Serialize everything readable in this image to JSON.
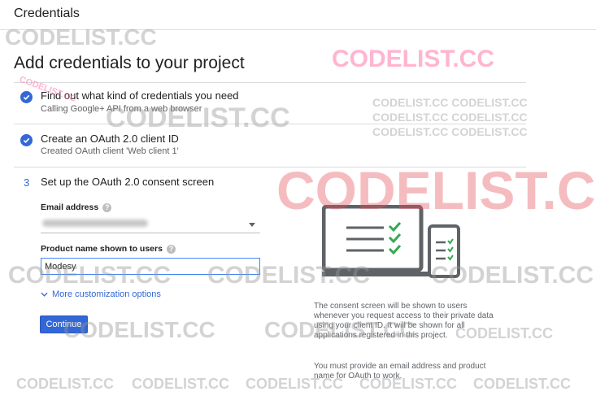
{
  "header": {
    "title": "Credentials"
  },
  "page": {
    "title": "Add credentials to your project"
  },
  "steps": [
    {
      "status": "complete",
      "title": "Find out what kind of credentials you need",
      "subtitle": "Calling Google+ API from a web browser"
    },
    {
      "status": "complete",
      "title": "Create an OAuth 2.0 client ID",
      "subtitle": "Created OAuth client 'Web client 1'"
    },
    {
      "status": "current",
      "number": "3",
      "title": "Set up the OAuth 2.0 consent screen"
    }
  ],
  "form": {
    "email_label": "Email address",
    "email_value": "",
    "product_label": "Product name shown to users",
    "product_value": "Modesy",
    "more_options": "More customization options",
    "continue": "Continue",
    "help_glyph": "?"
  },
  "info": {
    "paragraph1": "The consent screen will be shown to users whenever you request access to their private data using your client ID. It will be shown for all applications registered in this project.",
    "paragraph2": "You must provide an email address and product name for OAuth to work."
  },
  "watermark": {
    "text": "CODELIST.CC",
    "row_text": "CODELIST.CC CODELIST.CC"
  },
  "colors": {
    "accent": "#3367d6",
    "check": "#34a853",
    "device": "#5f6368"
  },
  "icons": {
    "step_done": "check-circle-icon",
    "help": "help-icon",
    "expand": "chevron-down-icon",
    "dropdown": "caret-down-icon"
  }
}
